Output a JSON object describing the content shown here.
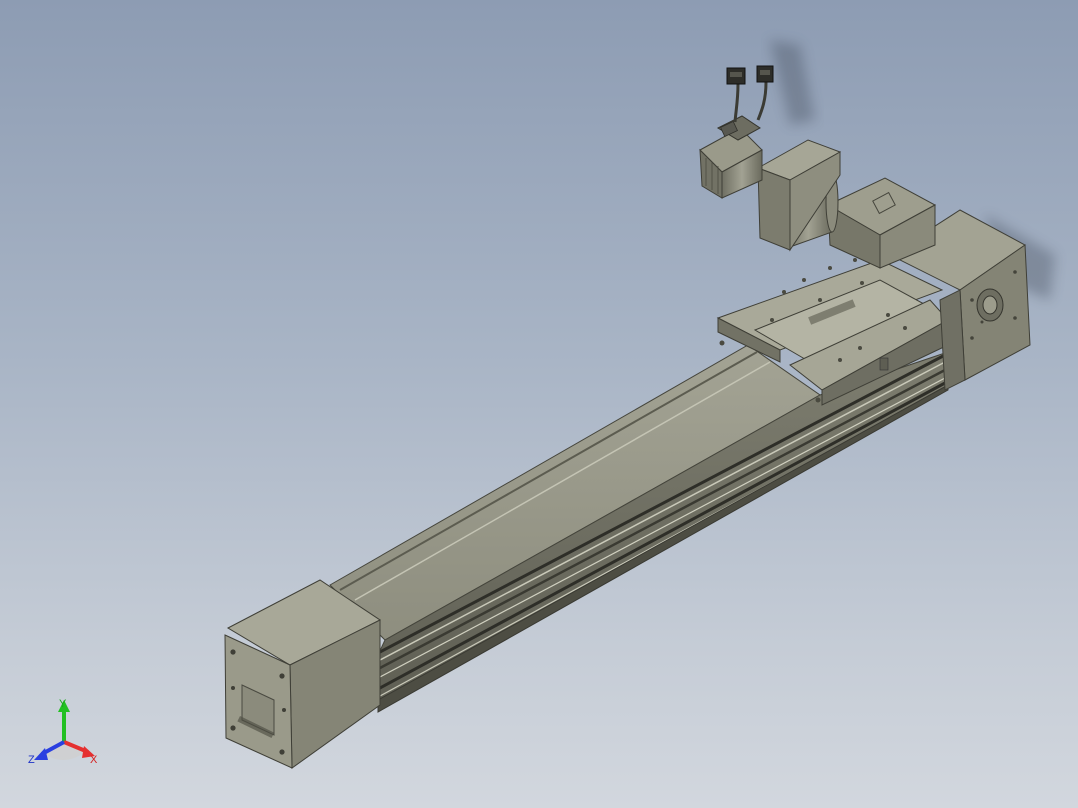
{
  "viewport": {
    "background_top": "#8d9cb3",
    "background_bottom": "#d2d7de"
  },
  "model": {
    "body_color": "#8c8c7c",
    "dark_color": "#55554a",
    "light_color": "#b0b0a0",
    "slider_logo_text": "",
    "endcap_logo_text": ""
  },
  "triad": {
    "x_label": "X",
    "y_label": "Y",
    "z_label": "Z",
    "x_color": "#e53030",
    "y_color": "#22c022",
    "z_color": "#2a3fe0"
  }
}
